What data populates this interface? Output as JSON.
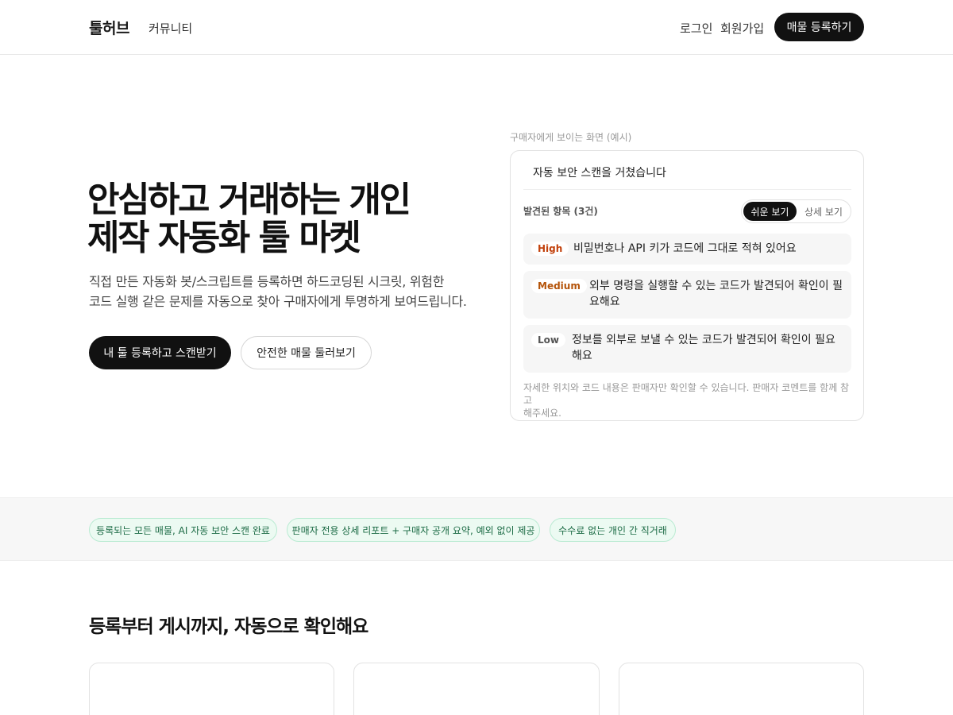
{
  "header": {
    "logo": "툴허브",
    "nav_community": "커뮤니티",
    "login": "로그인",
    "signup": "회원가입",
    "register_button": "매물 등록하기"
  },
  "hero": {
    "title_line1": "안심하고 거래하는 개인",
    "title_line2": "제작 자동화 툴 마켓",
    "subtitle_line1": "직접 만든 자동화 봇/스크립트를 등록하면 하드코딩된 시크릿, 위험한",
    "subtitle_line2": "코드 실행 같은 문제를 자동으로 찾아 구매자에게 투명하게 보여드립니다.",
    "primary_button": "내 툴 등록하고 스캔받기",
    "secondary_button": "안전한 매물 둘러보기"
  },
  "preview": {
    "caption": "구매자에게 보이는 화면 (예시)",
    "card_title": "자동 보안 스캔을 거쳤습니다",
    "found_label": "발견된 항목 (3건)",
    "toggle_easy": "쉬운 보기",
    "toggle_detail": "상세 보기",
    "findings": [
      {
        "severity": "High",
        "color": "#c2410c",
        "text_line1": "비밀번호나 API 키가 코드에 그대로 적혀 있어요",
        "text_line2": ""
      },
      {
        "severity": "Medium",
        "color": "#b45309",
        "text_line1": "외부 명령을 실행할 수 있는 코드가 발견되어 확인이 필",
        "text_line2": "요해요"
      },
      {
        "severity": "Low",
        "color": "#555555",
        "text_line1": "정보를 외부로 보낼 수 있는 코드가 발견되어 확인이 필요",
        "text_line2": "해요"
      }
    ],
    "note_line1": "자세한 위치와 코드 내용은 판매자만 확인할 수 있습니다. 판매자 코멘트를 함께 참고",
    "note_line2": "해주세요."
  },
  "badges": [
    "등록되는 모든 매물, AI 자동 보안 스캔 완료",
    "판매자 전용 상세 리포트 + 구매자 공개 요약, 예외 없이 제공",
    "수수료 없는 개인 간 직거래"
  ],
  "section": {
    "title": "등록부터 게시까지, 자동으로 확인해요"
  },
  "colors": {
    "primary": "#111111",
    "badge_bg": "#ecfaf2",
    "badge_text": "#1c6b45"
  }
}
